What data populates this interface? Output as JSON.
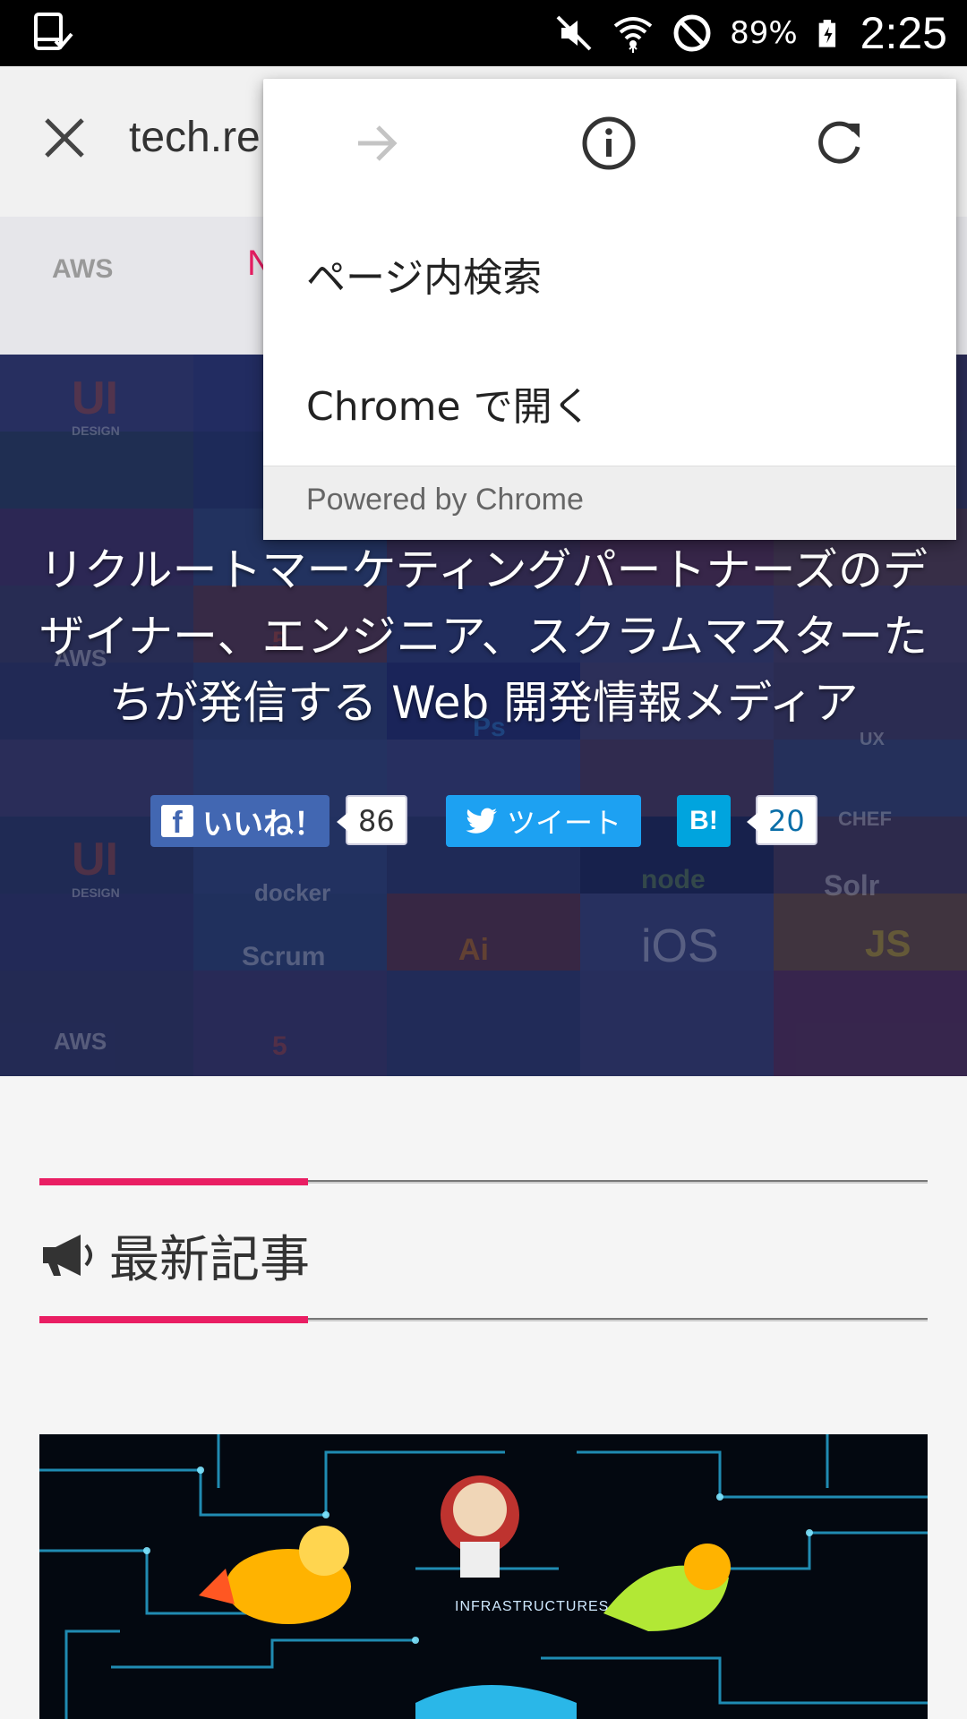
{
  "status_bar": {
    "battery_percent": "89%",
    "time": "2:25"
  },
  "toolbar": {
    "url": "tech.re"
  },
  "hero": {
    "nav_strip_aws": "AWS",
    "nav_strip_partial": "N",
    "tagline": "リクルートマーケティングパートナーズのデザイナー、エンジニア、スクラムマスターたちが発信する Web 開発情報メディア",
    "tiles": [
      "UI DESIGN",
      "AWS",
      "Scrum",
      "Ai",
      "iOS",
      "JS",
      "docker",
      "node",
      "Solr",
      "CHEF",
      "HTML5",
      "UX",
      "Ps"
    ],
    "share": {
      "like_label": "いいね！",
      "like_count": "86",
      "tweet_label": "ツイート",
      "hatena_label": "B!",
      "hatena_count": "20"
    }
  },
  "latest": {
    "title": "最新記事",
    "thumbnail_caption": "INFRASTRUCTURES"
  },
  "menu": {
    "items": [
      {
        "label": "ページ内検索"
      },
      {
        "label": "Chrome で開く"
      }
    ],
    "footer": "Powered by Chrome"
  },
  "colors": {
    "accent_pink": "#e91e63",
    "facebook": "#4267b2",
    "twitter": "#1da1f2",
    "hatena": "#00a4de"
  }
}
